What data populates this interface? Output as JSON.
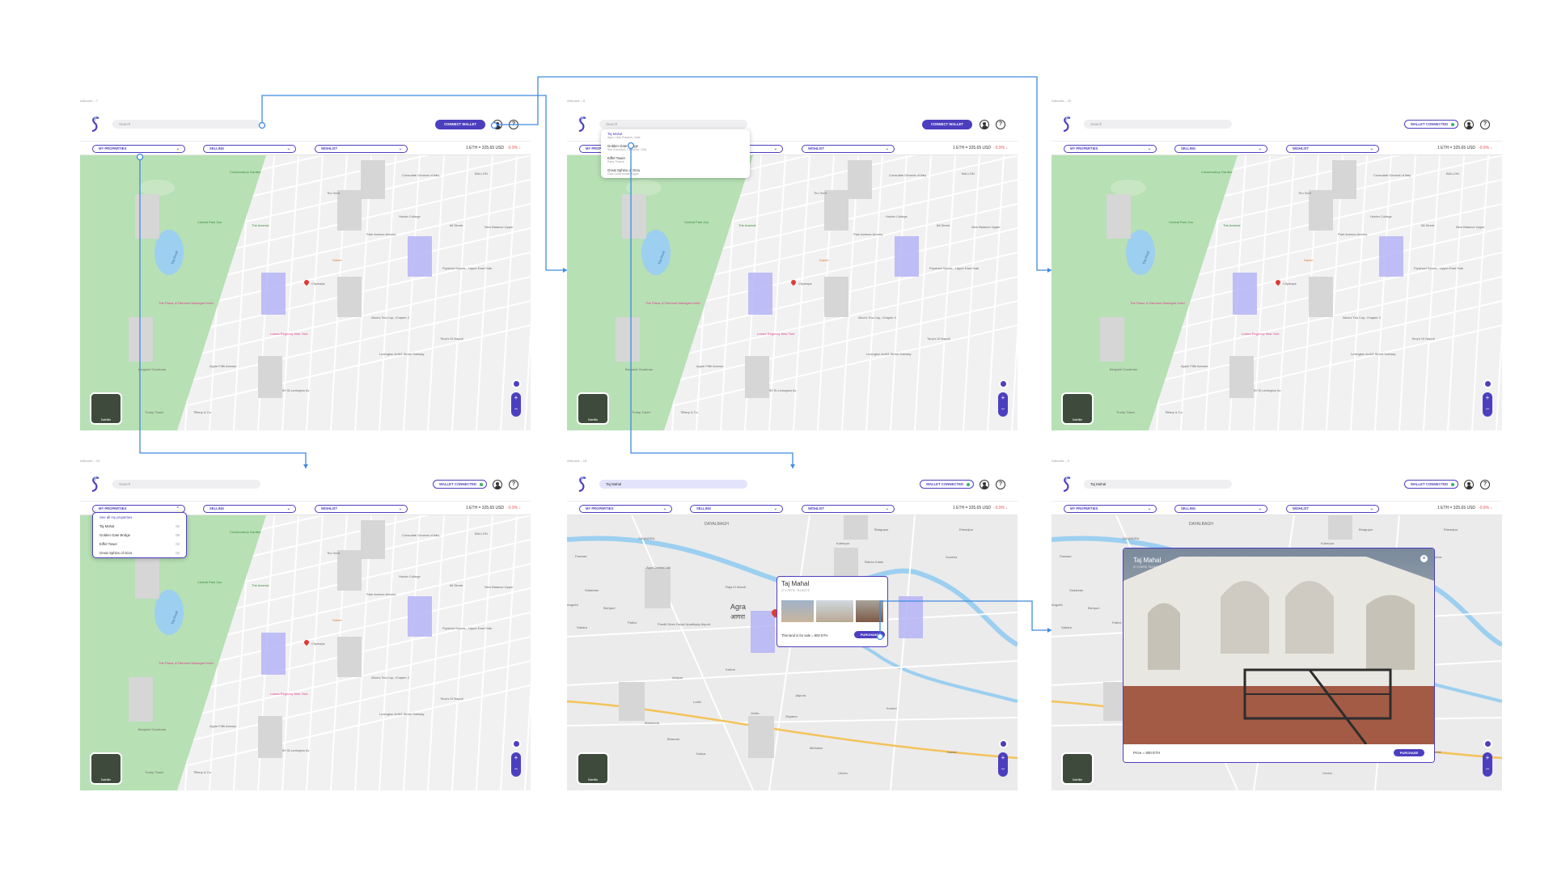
{
  "boards": [
    {
      "label": "Artboard – 7",
      "search_placeholder": "Search",
      "search_value": "",
      "wallet_label": "CONNECT WALLET",
      "connected": false
    },
    {
      "label": "Artboard – 8",
      "search_placeholder": "Search",
      "search_value": "",
      "wallet_label": "CONNECT WALLET",
      "connected": false
    },
    {
      "label": "Artboard – 20",
      "search_placeholder": "Search",
      "search_value": "",
      "wallet_label": "WALLET CONNECTED",
      "connected": true
    },
    {
      "label": "Artboard – 19",
      "search_placeholder": "Search",
      "search_value": "",
      "wallet_label": "WALLET CONNECTED",
      "connected": true
    },
    {
      "label": "Artboard – 18",
      "search_placeholder": "Search",
      "search_value": "Taj Mahal",
      "wallet_label": "WALLET CONNECTED",
      "connected": true
    },
    {
      "label": "Artboard – 9",
      "search_placeholder": "Search",
      "search_value": "Taj Mahal",
      "wallet_label": "WALLET CONNECTED",
      "connected": true
    }
  ],
  "filters": {
    "my_properties": "MY PROPERTIES",
    "selling": "SELLING",
    "wishlist": "WISHLIST"
  },
  "rate": {
    "text": "1 ETH = 325.65 USD",
    "change": "-0.9% ↓"
  },
  "satellite_label": "Satellite",
  "nyc_labels": {
    "conservatory": "Conservatory Garden",
    "consulate": "Consulate General of Italy",
    "hunter": "Hunter College",
    "central_park_zoo": "Central Park Zoo",
    "arsenal": "The Arsenal",
    "park_ave_armory": "Park Avenue Armory",
    "cityMaps": "Citymaps",
    "plaza": "The Plaza, A Fairmont Managed Hotel",
    "lowes": "Loews Regency New York",
    "lexington": "Lexington Av/63 Street Subway",
    "apple": "Apple Fifth Avenue",
    "bergdorf": "Bergdorf Goodman",
    "trump": "Trump Tower",
    "tiffany": "Tiffany & Co",
    "st59": "59 St-Lexington Av",
    "new_balance": "New Balance Upper",
    "flywheel": "Flywheel Sports - Upper East Side",
    "alice": "Alice's Tea Cup, Chapter 2",
    "tony": "Tony's Di Napoli",
    "st68": "68 Street",
    "daniel": "Daniel",
    "the_pond": "The Pond",
    "tiro": "Tiro Scrit",
    "balon": "BALLON"
  },
  "search_results": [
    {
      "name": "Taj Mahal",
      "location": "Agra, Uttar Pradesh, India"
    },
    {
      "name": "Golden Gate Bridge",
      "location": "San Francisco, California, USA"
    },
    {
      "name": "Eiffel Tower",
      "location": "Paris, France"
    },
    {
      "name": "Great Sphinx of Giza",
      "location": "Giza Governorate, Egypt"
    }
  ],
  "my_properties_menu": [
    {
      "label": "See all my properties",
      "count": ""
    },
    {
      "label": "Taj Mahal",
      "count": "02"
    },
    {
      "label": "Golden Gate Bridge",
      "count": "05"
    },
    {
      "label": "Eiffel Tower",
      "count": "02"
    },
    {
      "label": "Great Sphinx of Giza",
      "count": "02"
    }
  ],
  "agra_labels": {
    "agra_en": "Agra",
    "agra_hi": "आगरा",
    "dayalbagh": "DAYALBAGH",
    "sikandra": "SIKANDRA",
    "bhagupur": "Bhagupur",
    "etmadpur": "Etmadpur",
    "kuberpur": "Kuberpur",
    "surahra": "Surahra",
    "rahan_kalan": "Rahan Kalan",
    "raja_ki_mandi": "Raja Ki Mandi",
    "central_jail": "Agra Central Jail",
    "pandit": "Pandit Deen Dayal Upadhyay Airport",
    "panwari": "Panwari",
    "sadarban": "Sadarban",
    "anguthi": "Anguthi",
    "bichpuri": "Bichpuri",
    "pathoi": "Pathoi",
    "sahara": "Sahara",
    "kakua": "Kakua",
    "markenda": "Markenda",
    "bhandai": "Bhandai",
    "azizpur": "Azizpur",
    "kundol": "Kundol",
    "shyamo": "Shyamo",
    "jaipura": "Jaipura",
    "gutila": "Gutila",
    "daulat": "Daulat",
    "unchia": "Uncha",
    "kahrai": "Kahrai",
    "taj_pin": "Taj Mahal",
    "taj_pin_sub": "Temporarily closed",
    "lodhi": "Lodhi",
    "midhakur": "Midhakur"
  },
  "taj_card": {
    "title": "Taj Mahal",
    "coords": "27.1750°N, 78.0422°E",
    "sale_text": "This land is for sale = 800 ETH",
    "purchase": "PURCHASE"
  },
  "taj_modal": {
    "title": "Taj Mahal",
    "coords": "27.1750°N, 78.0422°E",
    "price": "Price = 800 ETH",
    "purchase": "PURCHASE",
    "close": "×"
  },
  "colors": {
    "accent": "#4c3fbf",
    "flow": "#3f8ae0",
    "property": "#b6b4f6",
    "park": "#b7e0b4",
    "water": "#9ccff0"
  }
}
